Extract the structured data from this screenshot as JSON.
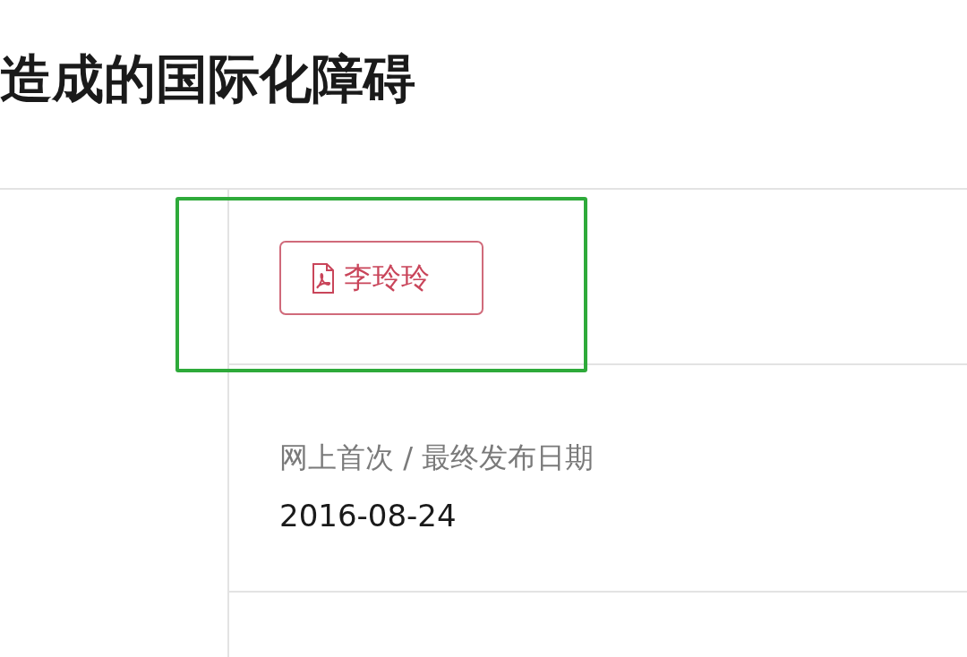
{
  "title": "造成的国际化障碍",
  "author_button": {
    "label": "李玲玲"
  },
  "publication": {
    "label": "网上首次 / 最终发布日期",
    "value": "2016-08-24"
  }
}
